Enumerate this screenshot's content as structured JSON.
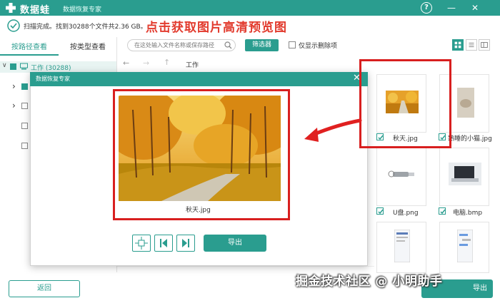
{
  "app": {
    "name": "数据蛙",
    "subtitle": "数据恢复专家"
  },
  "window_controls": {
    "help": "?",
    "minimize": "—",
    "close": "✕"
  },
  "status": {
    "scan_text": "扫描完成。找到30288个文件共2.36 GB。"
  },
  "annotation": {
    "headline": "点击获取图片高清预览图"
  },
  "sidebar": {
    "tabs": [
      {
        "label": "按路径查看"
      },
      {
        "label": "按类型查看"
      }
    ],
    "tree_root": {
      "label": "工作 (30288)"
    }
  },
  "toolbar": {
    "search_placeholder": "在这处输入文件名称或保存路径",
    "filter_label": "筛选器",
    "only_deleted_label": "仅显示删除项"
  },
  "nav": {
    "back": "←",
    "forward": "→",
    "up": "↑",
    "path": "工作"
  },
  "grid": {
    "items": [
      {
        "label": "秋天.jpg",
        "checked": true
      },
      {
        "label": "熟睡的小猫.jpg",
        "checked": true
      },
      {
        "label": "U盘.png",
        "checked": true
      },
      {
        "label": "电脑.bmp",
        "checked": true
      }
    ]
  },
  "dialog": {
    "title": "数据恢复专家",
    "close": "✕",
    "image_name": "秋天.jpg",
    "export_label": "导出"
  },
  "footer": {
    "back_label": "返回",
    "export_label": "导出"
  },
  "watermark": "掘金技术社区 @ 小明助手",
  "colors": {
    "accent": "#2a9d8f",
    "annotation_red": "#d81f1f"
  }
}
